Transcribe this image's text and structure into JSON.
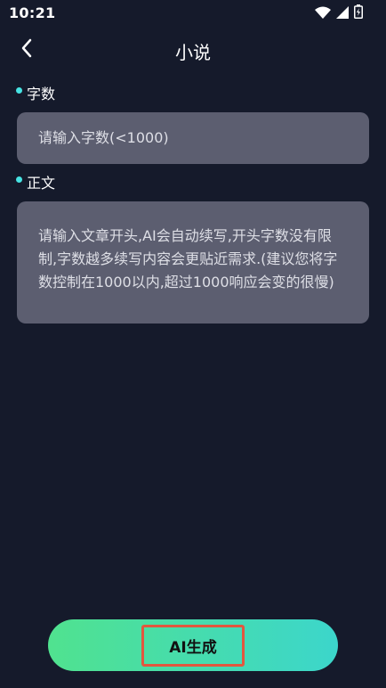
{
  "status_bar": {
    "time": "10:21"
  },
  "nav": {
    "title": "小说"
  },
  "word_count": {
    "label": "字数",
    "placeholder": "请输入字数(<1000)",
    "value": ""
  },
  "body_text": {
    "label": "正文",
    "placeholder": "请输入文章开头,AI会自动续写,开头字数没有限制,字数越多续写内容会更贴近需求.(建议您将字数控制在1000以内,超过1000响应会变的很慢)",
    "value": ""
  },
  "generate_button": {
    "label": "AI生成",
    "gradient_start": "#50E28F",
    "gradient_end": "#3CD6CB"
  },
  "colors": {
    "background": "#151A2B",
    "field_background": "#5C5E70",
    "label_dot": "#47E3E3",
    "highlight_border": "#E2573E"
  },
  "icons": [
    "wifi-icon",
    "signal-icon",
    "battery-icon",
    "back-arrow-icon"
  ]
}
